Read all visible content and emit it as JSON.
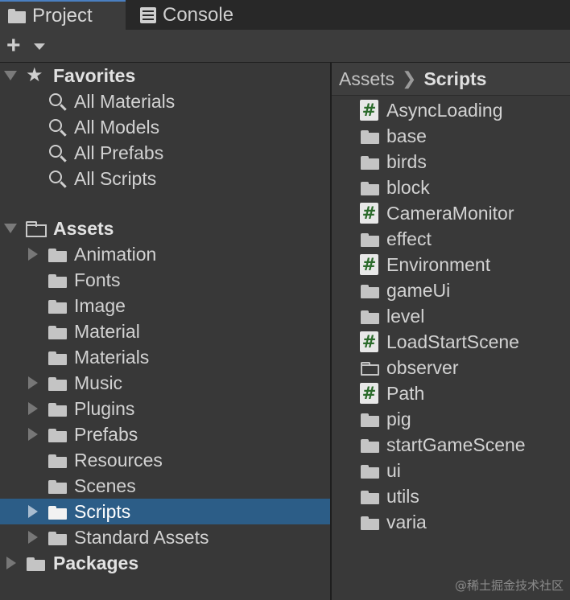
{
  "tabs": [
    {
      "label": "Project",
      "icon": "folder-icon",
      "active": true
    },
    {
      "label": "Console",
      "icon": "console-icon",
      "active": false
    }
  ],
  "toolbar": {
    "add_label": "+"
  },
  "tree": {
    "favorites": {
      "label": "Favorites",
      "items": [
        "All Materials",
        "All Models",
        "All Prefabs",
        "All Scripts"
      ]
    },
    "assets": {
      "label": "Assets",
      "items": [
        {
          "label": "Animation",
          "expandable": true
        },
        {
          "label": "Fonts",
          "expandable": false
        },
        {
          "label": "Image",
          "expandable": false
        },
        {
          "label": "Material",
          "expandable": false
        },
        {
          "label": "Materials",
          "expandable": false
        },
        {
          "label": "Music",
          "expandable": true
        },
        {
          "label": "Plugins",
          "expandable": true
        },
        {
          "label": "Prefabs",
          "expandable": true
        },
        {
          "label": "Resources",
          "expandable": false
        },
        {
          "label": "Scenes",
          "expandable": false
        },
        {
          "label": "Scripts",
          "expandable": true,
          "selected": true
        },
        {
          "label": "Standard Assets",
          "expandable": true
        }
      ]
    },
    "packages": {
      "label": "Packages"
    }
  },
  "breadcrumb": {
    "root": "Assets",
    "current": "Scripts"
  },
  "files": [
    {
      "name": "AsyncLoading",
      "kind": "script"
    },
    {
      "name": "base",
      "kind": "folder"
    },
    {
      "name": "birds",
      "kind": "folder"
    },
    {
      "name": "block",
      "kind": "folder"
    },
    {
      "name": "CameraMonitor",
      "kind": "script"
    },
    {
      "name": "effect",
      "kind": "folder"
    },
    {
      "name": "Environment",
      "kind": "script"
    },
    {
      "name": "gameUi",
      "kind": "folder"
    },
    {
      "name": "level",
      "kind": "folder"
    },
    {
      "name": "LoadStartScene",
      "kind": "script"
    },
    {
      "name": "observer",
      "kind": "empty-folder"
    },
    {
      "name": "Path",
      "kind": "script"
    },
    {
      "name": "pig",
      "kind": "folder"
    },
    {
      "name": "startGameScene",
      "kind": "folder"
    },
    {
      "name": "ui",
      "kind": "folder"
    },
    {
      "name": "utils",
      "kind": "folder"
    },
    {
      "name": "varia",
      "kind": "folder"
    }
  ],
  "watermark": "@稀土掘金技术社区",
  "colors": {
    "selection": "#2c5d87",
    "script_hash": "#2b6b2b",
    "tab_accent": "#4a7fc1"
  }
}
